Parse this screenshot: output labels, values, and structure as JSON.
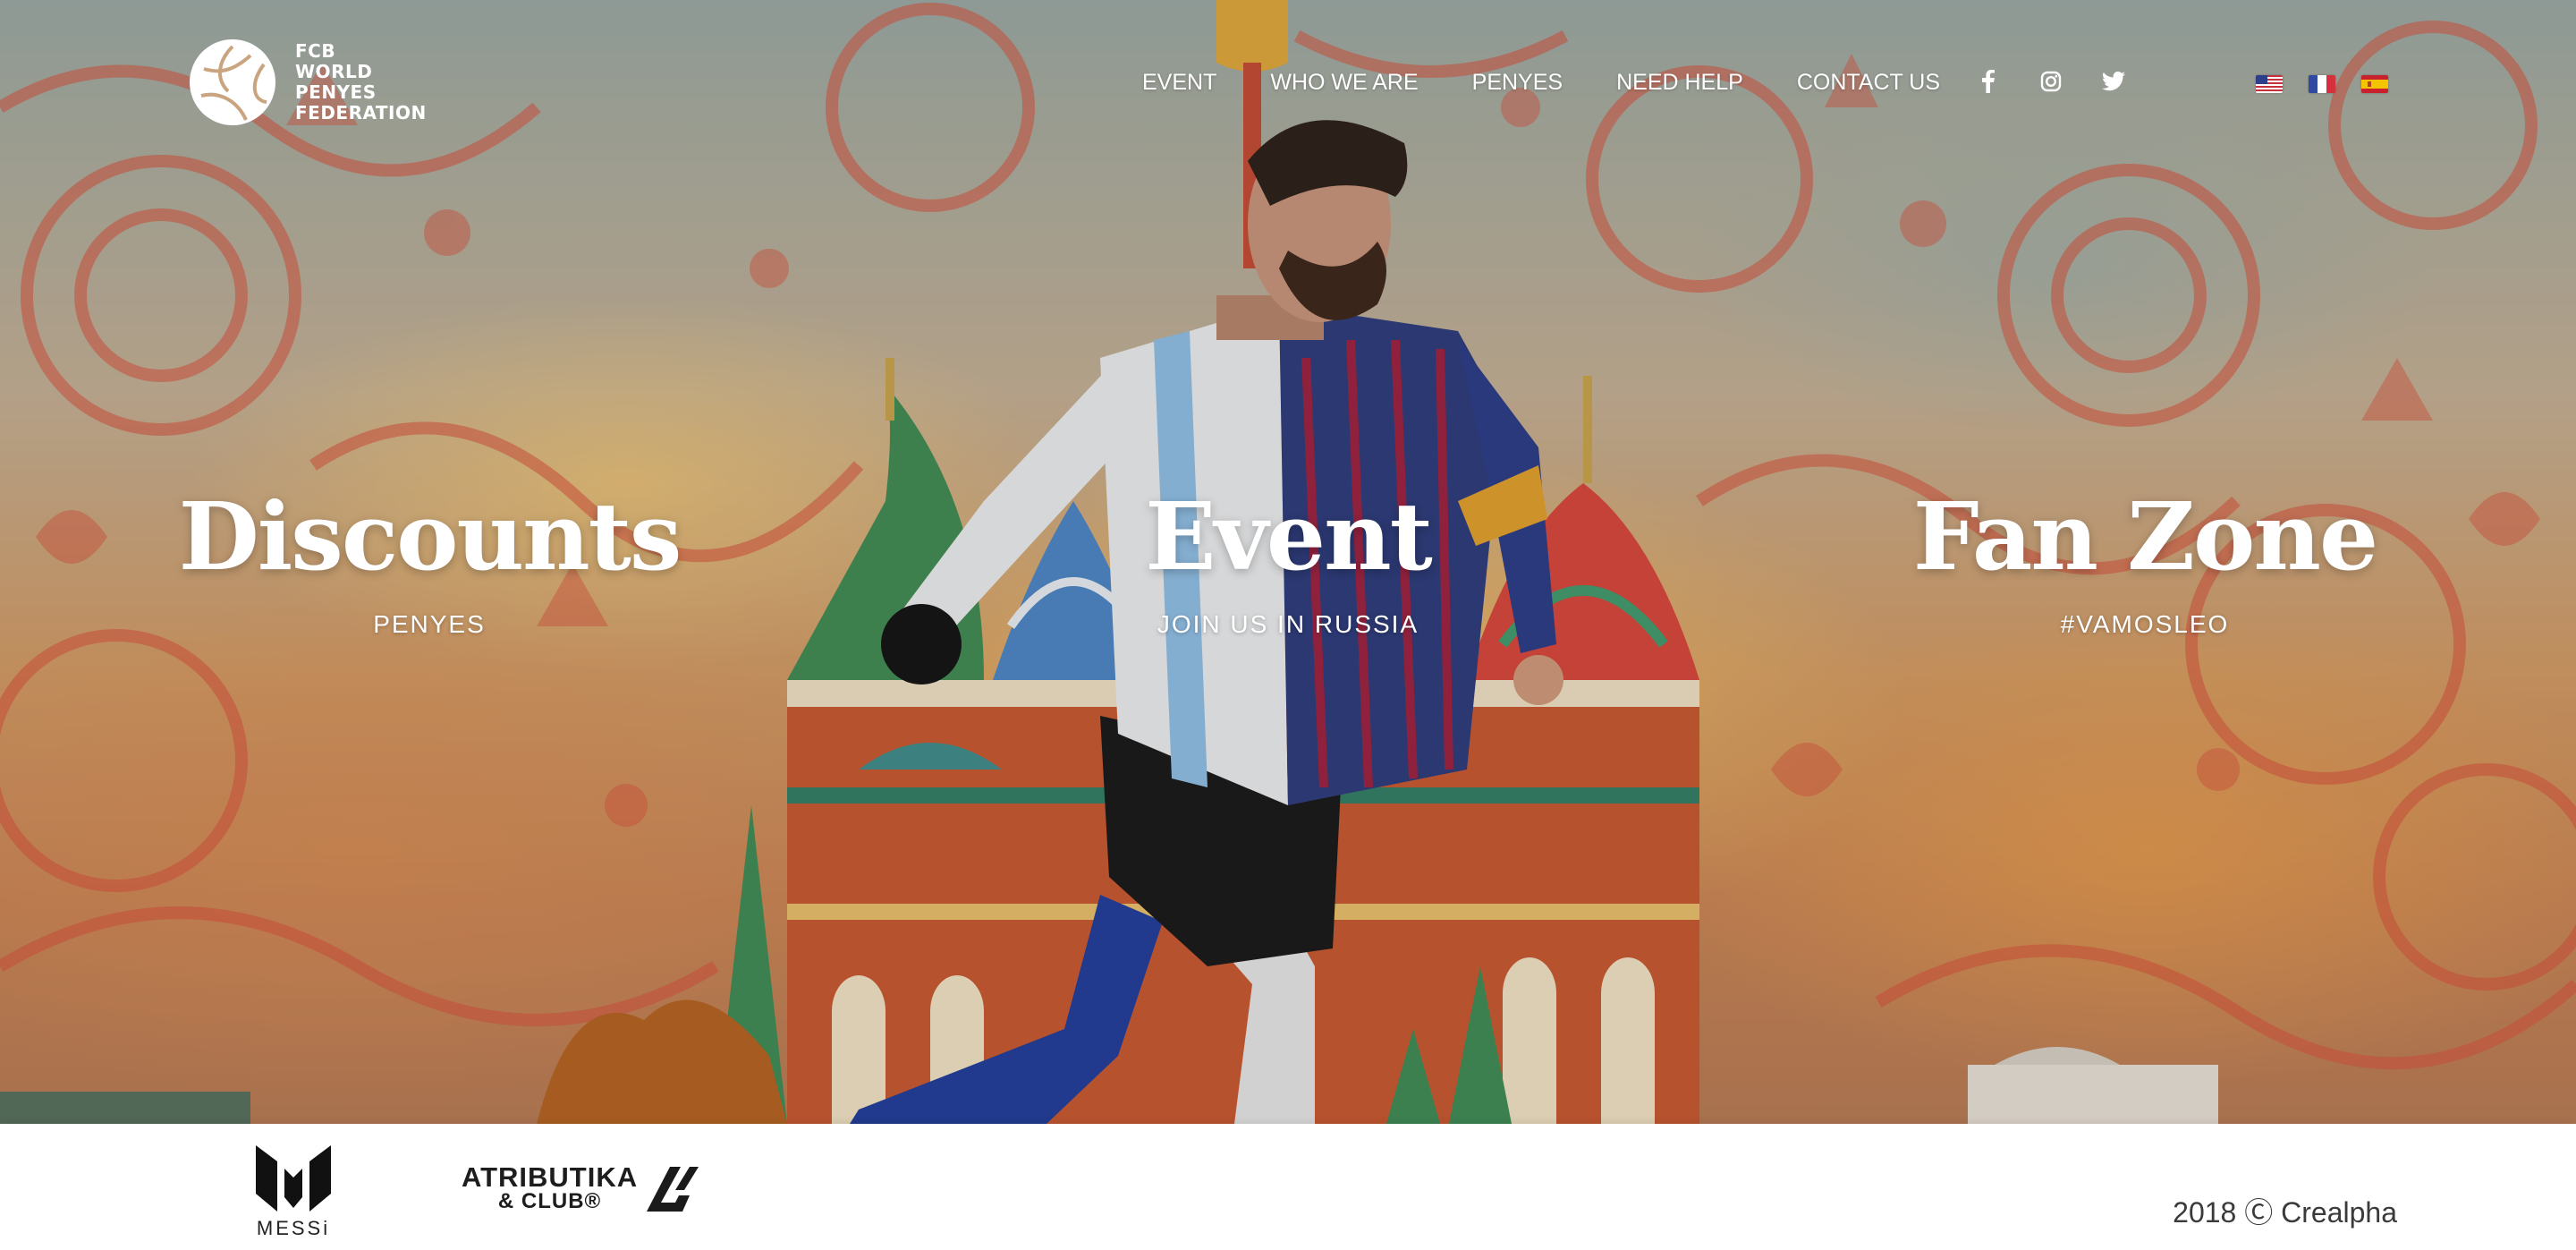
{
  "brand": {
    "logo_lines": [
      "FCB",
      "WORLD",
      "PENYES",
      "FEDERATION"
    ]
  },
  "nav": {
    "items": [
      {
        "label": "EVENT"
      },
      {
        "label": "WHO WE ARE"
      },
      {
        "label": "PENYES"
      },
      {
        "label": "NEED HELP"
      },
      {
        "label": "CONTACT US"
      }
    ]
  },
  "social": [
    "facebook-icon",
    "instagram-icon",
    "twitter-icon"
  ],
  "languages": [
    {
      "name": "us-flag-icon"
    },
    {
      "name": "france-flag-icon"
    },
    {
      "name": "spain-flag-icon"
    }
  ],
  "hero": {
    "blocks": [
      {
        "title": "Discounts",
        "subtitle": "PENYES"
      },
      {
        "title": "Event",
        "subtitle": "JOIN US IN RUSSIA"
      },
      {
        "title": "Fan Zone",
        "subtitle": "#VAMOSLEO"
      }
    ]
  },
  "footer": {
    "sponsor_messi": "MESSi",
    "sponsor_atr_line1": "ATRIBUTIKA",
    "sponsor_atr_line2": "& CLUB®",
    "copyright": "2018 Ⓒ Crealpha"
  },
  "colors": {
    "pattern": "#d9503a",
    "text": "#ffffff",
    "footer_text": "#3a3a3a"
  }
}
